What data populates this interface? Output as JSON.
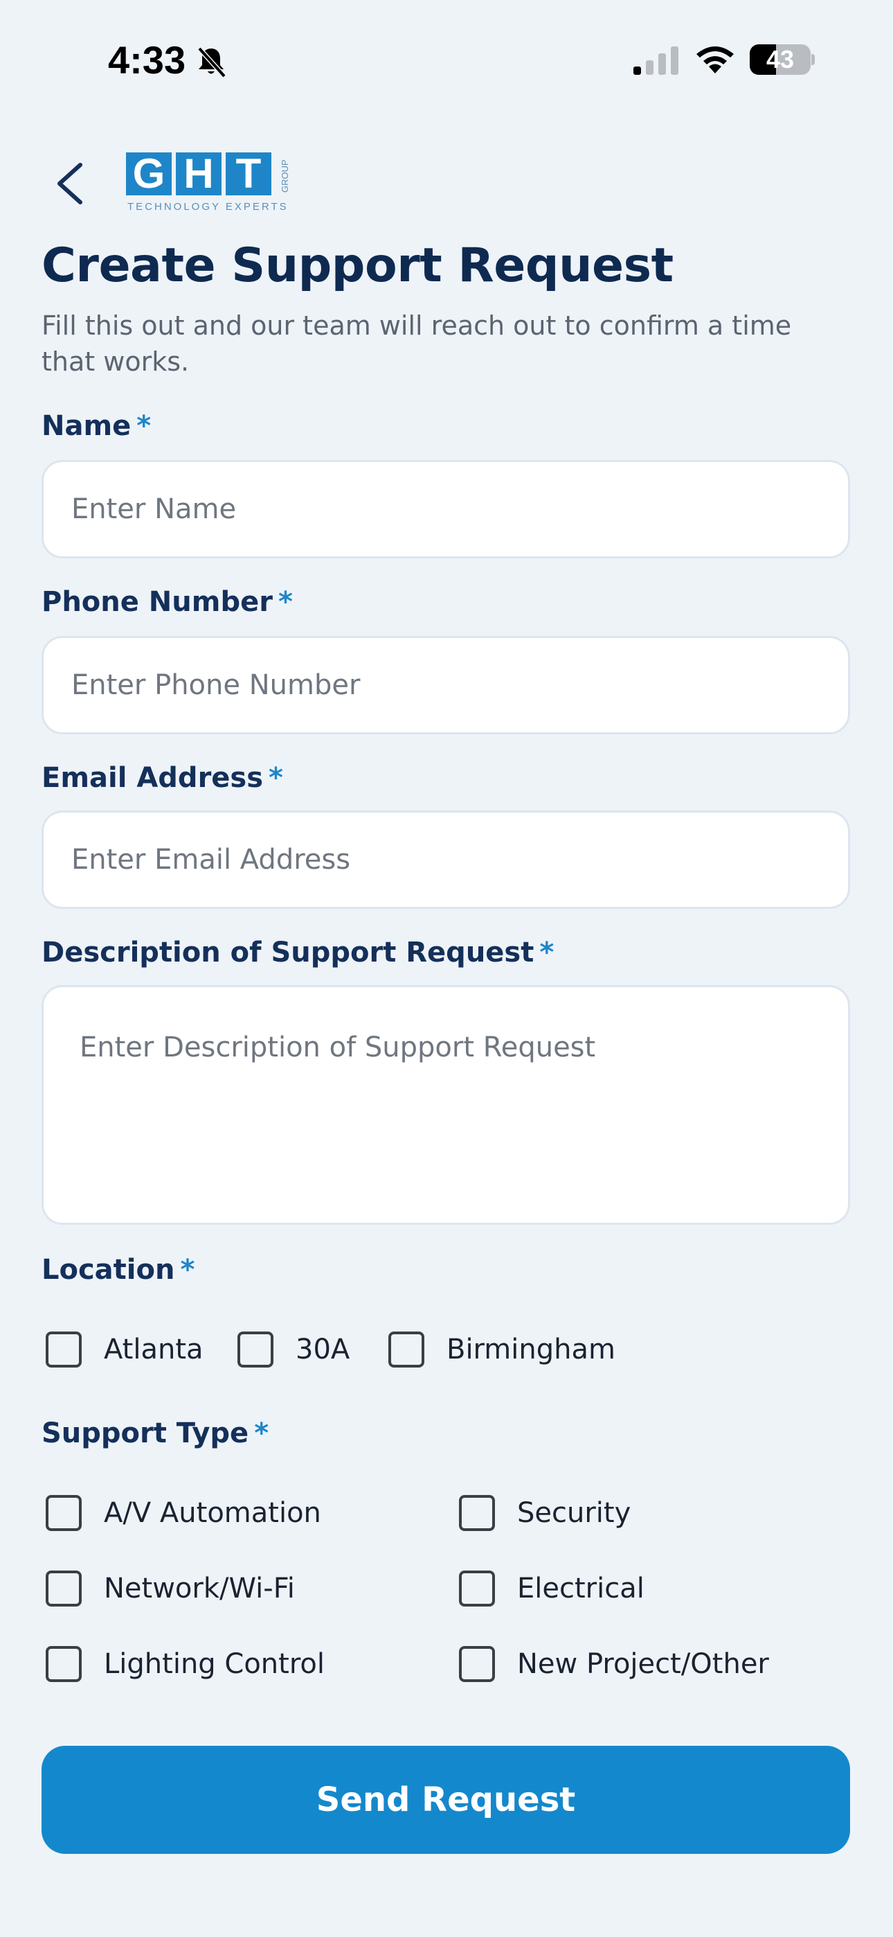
{
  "status_bar": {
    "time": "4:33",
    "battery_percent": "43",
    "battery_level": 0.43
  },
  "header": {
    "logo_letters": [
      "G",
      "H",
      "T"
    ],
    "logo_tagline": "TECHNOLOGY EXPERTS",
    "logo_group": "GROUP"
  },
  "page": {
    "title": "Create Support Request",
    "subtitle": "Fill this out and our team will reach out to confirm a time that works."
  },
  "form": {
    "required_mark": "*",
    "name": {
      "label": "Name",
      "placeholder": "Enter Name",
      "value": ""
    },
    "phone": {
      "label": "Phone Number",
      "placeholder": "Enter Phone Number",
      "value": ""
    },
    "email": {
      "label": "Email Address",
      "placeholder": "Enter Email Address",
      "value": ""
    },
    "description": {
      "label": "Description of Support Request",
      "placeholder": "Enter Description of Support Request",
      "value": ""
    },
    "location": {
      "label": "Location",
      "options": [
        {
          "label": "Atlanta",
          "checked": false
        },
        {
          "label": "30A",
          "checked": false
        },
        {
          "label": "Birmingham",
          "checked": false
        }
      ]
    },
    "support_type": {
      "label": "Support Type",
      "options": [
        {
          "label": "A/V Automation",
          "checked": false
        },
        {
          "label": "Security",
          "checked": false
        },
        {
          "label": "Network/Wi-Fi",
          "checked": false
        },
        {
          "label": "Electrical",
          "checked": false
        },
        {
          "label": "Lighting Control",
          "checked": false
        },
        {
          "label": "New Project/Other",
          "checked": false
        }
      ]
    },
    "submit_label": "Send Request"
  },
  "colors": {
    "background": "#eef3f8",
    "accent": "#1488cc",
    "heading": "#0f2a50",
    "logo_blue": "#1e86c8"
  },
  "icons": [
    "bell-slash-icon",
    "cellular-signal-icon",
    "wifi-icon",
    "battery-icon",
    "back-chevron-icon"
  ]
}
